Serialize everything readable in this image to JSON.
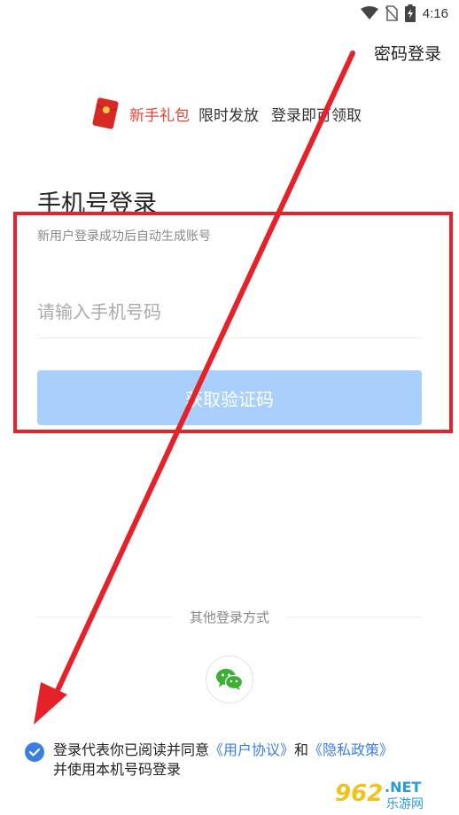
{
  "status_bar": {
    "time": "4:16",
    "icons": [
      "wifi-icon",
      "no-sim-icon",
      "battery-charging-icon"
    ]
  },
  "header": {
    "password_login": "密码登录"
  },
  "promo": {
    "icon": "red-envelope-icon",
    "gift_label": "新手礼包",
    "limited_label": "限时发放",
    "claim_label": "登录即可领取"
  },
  "login": {
    "title": "手机号登录",
    "subtitle": "新用户登录成功后自动生成账号",
    "phone_placeholder": "请输入手机号码",
    "phone_value": "",
    "get_code_label": "获取验证码"
  },
  "other_login": {
    "label": "其他登录方式",
    "wechat_icon": "wechat-icon"
  },
  "agreement": {
    "checked": true,
    "prefix": "登录代表你已阅读并同意",
    "user_agreement": "《用户协议》",
    "and": "和",
    "privacy_policy": "《隐私政策》",
    "suffix": "并使用本机号码登录"
  },
  "watermark": {
    "number": "962",
    "net": ".NET",
    "site": "乐游网"
  },
  "colors": {
    "accent_blue": "#3b7de0",
    "button_disabled": "#a9d0fc",
    "gift_red": "#e54635",
    "annotation_red": "#e5222a"
  }
}
